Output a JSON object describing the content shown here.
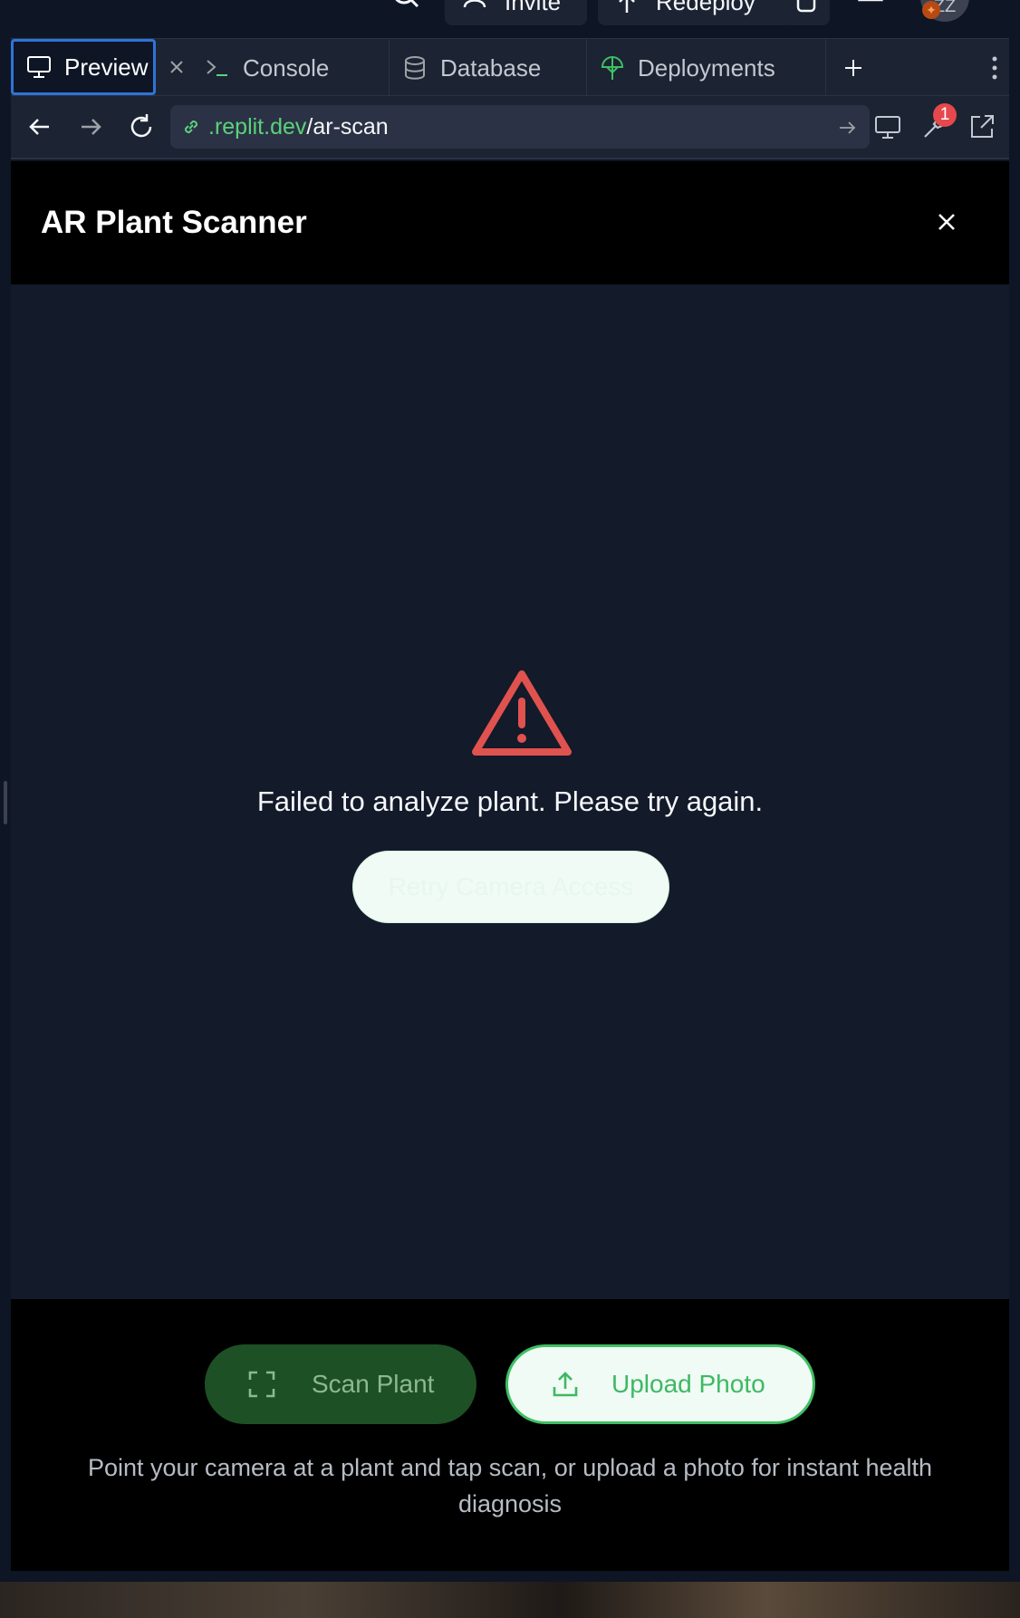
{
  "top_bar": {
    "invite_label": "Invite",
    "redeploy_label": "Redeploy",
    "avatar_initials": "ZZ"
  },
  "pane_tabs": [
    {
      "label": "Preview",
      "icon": "monitor-icon",
      "active": true
    },
    {
      "label": "Console",
      "icon": "terminal-icon"
    },
    {
      "label": "Database",
      "icon": "database-icon"
    },
    {
      "label": "Deployments",
      "icon": "deployments-icon"
    }
  ],
  "address_bar": {
    "url_domain": ".replit.dev",
    "url_path": "/ar-scan",
    "devtools_badge": "1"
  },
  "app": {
    "title": "AR Plant Scanner",
    "error_message": "Failed to analyze plant. Please try again.",
    "retry_label": "Retry Camera Access",
    "scan_label": "Scan Plant",
    "upload_label": "Upload Photo",
    "hint": "Point your camera at a plant and tap scan, or upload a photo for instant health diagnosis"
  },
  "colors": {
    "accent_blue": "#2e74d6",
    "link_green": "#5bd17a",
    "error_red": "#e0524e",
    "scan_button_bg": "#1d5025",
    "upload_border": "#3fbf63"
  }
}
